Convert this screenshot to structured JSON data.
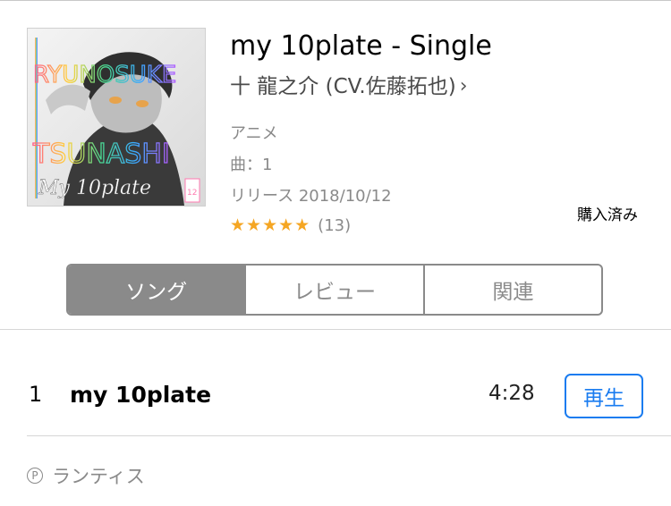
{
  "album": {
    "title": "my 10plate - Single",
    "artist": "十 龍之介 (CV.佐藤拓也)",
    "artist_chevron": "›",
    "genre": "アニメ",
    "track_count": "曲：1",
    "release": "リリース 2018/10/12",
    "stars": "★★★★★",
    "rating_count": "(13)",
    "purchased": "購入済み",
    "art_text": {
      "line1": "RYUNOSUKE",
      "line2": "TSUNASHI",
      "line3": "My 10plate",
      "badge": "12"
    }
  },
  "tabs": [
    {
      "label": "ソング",
      "active": true
    },
    {
      "label": "レビュー",
      "active": false
    },
    {
      "label": "関連",
      "active": false
    }
  ],
  "tracks": [
    {
      "number": "1",
      "title": "my 10plate",
      "duration": "4:28",
      "action": "再生"
    }
  ],
  "footer": {
    "phonogram_symbol": "P",
    "label": "ランティス"
  },
  "colors": {
    "accent": "#1a7cf0",
    "segment": "#8a8a8a",
    "stars": "#f5a623"
  }
}
